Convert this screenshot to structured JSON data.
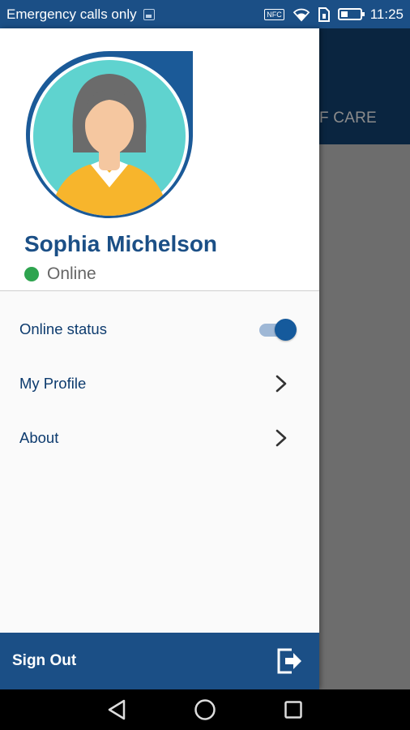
{
  "status_bar": {
    "carrier_text": "Emergency calls only",
    "nfc_label": "NFC",
    "time": "11:25"
  },
  "background_app": {
    "tab_fragment": "F CARE"
  },
  "drawer": {
    "user": {
      "name": "Sophia Michelson",
      "status": "Online",
      "status_color": "#2ea44f"
    },
    "menu": [
      {
        "label": "Online status",
        "control": "toggle",
        "toggle_on": true
      },
      {
        "label": "My Profile",
        "control": "chevron"
      },
      {
        "label": "About",
        "control": "chevron"
      }
    ],
    "sign_out_label": "Sign Out"
  },
  "colors": {
    "brand_blue": "#1b4f86",
    "menu_text": "#0d3b6e"
  },
  "icons": [
    "nfc-icon",
    "wifi-icon",
    "sim-icon",
    "battery-icon",
    "chevron-right-icon",
    "logout-icon",
    "back-icon",
    "home-icon",
    "recents-icon"
  ]
}
